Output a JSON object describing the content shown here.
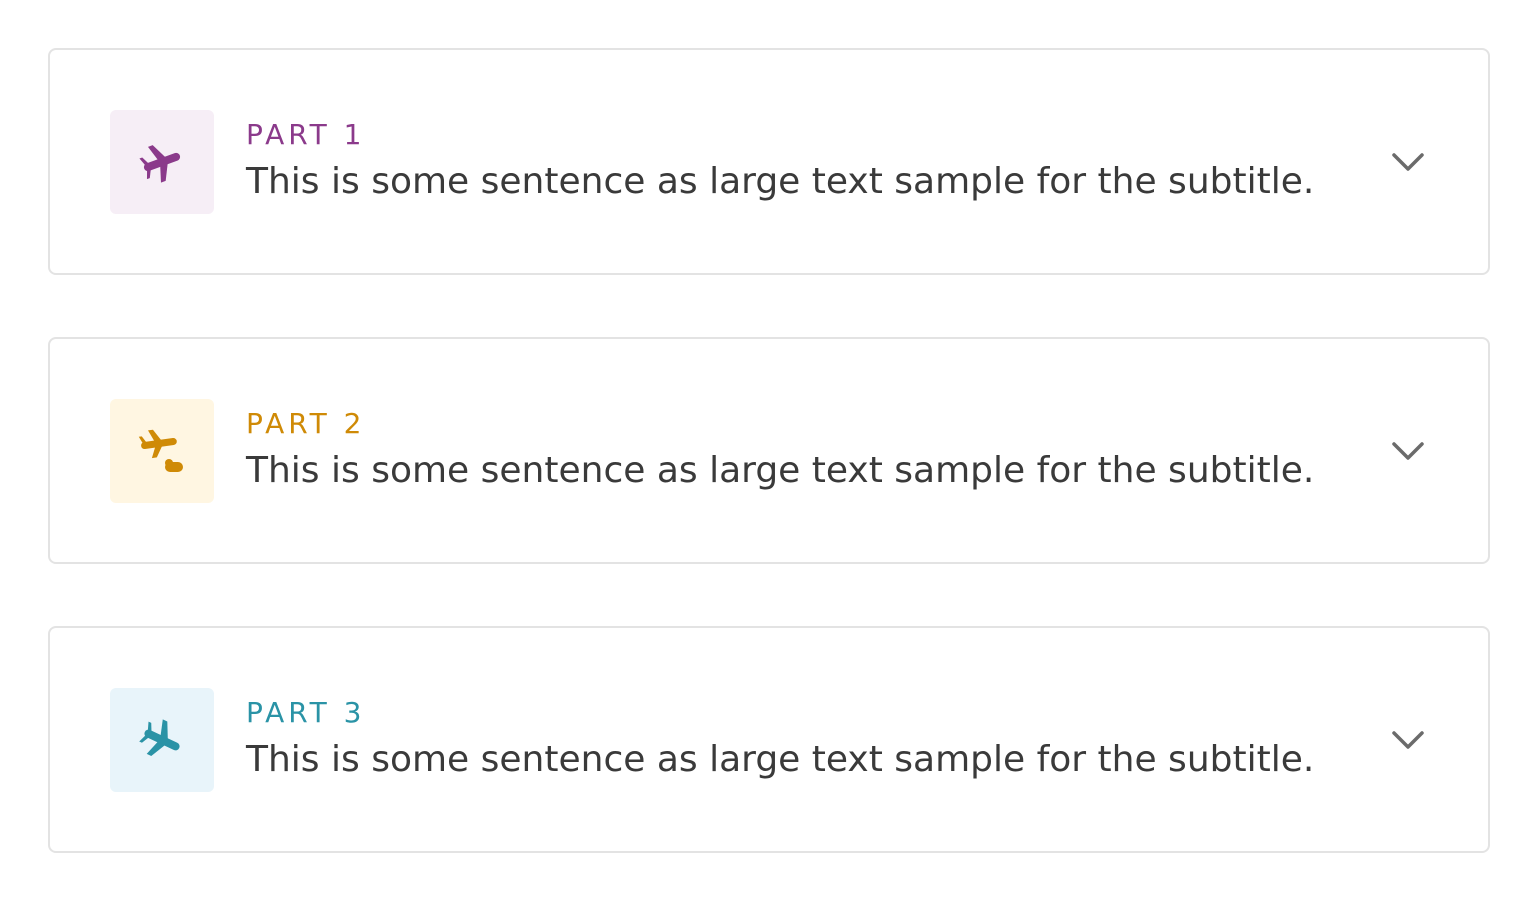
{
  "items": [
    {
      "label": "PART 1",
      "subtitle": "This is some sentence as large text sample for the subtitle.",
      "icon": "airplane-icon",
      "accent": "#8b3a8b",
      "tile_bg": "#f6eef6"
    },
    {
      "label": "PART 2",
      "subtitle": "This is some sentence as large text sample for the subtitle.",
      "icon": "airplane-departing-icon",
      "accent": "#cf8a06",
      "tile_bg": "#fff6e2"
    },
    {
      "label": "PART 3",
      "subtitle": "This is some sentence as large text sample for the subtitle.",
      "icon": "airplane-landing-icon",
      "accent": "#2a93a6",
      "tile_bg": "#e8f4fa"
    }
  ],
  "chevron_icon": "chevron-down-icon",
  "chevron_color": "#6b6b6b"
}
